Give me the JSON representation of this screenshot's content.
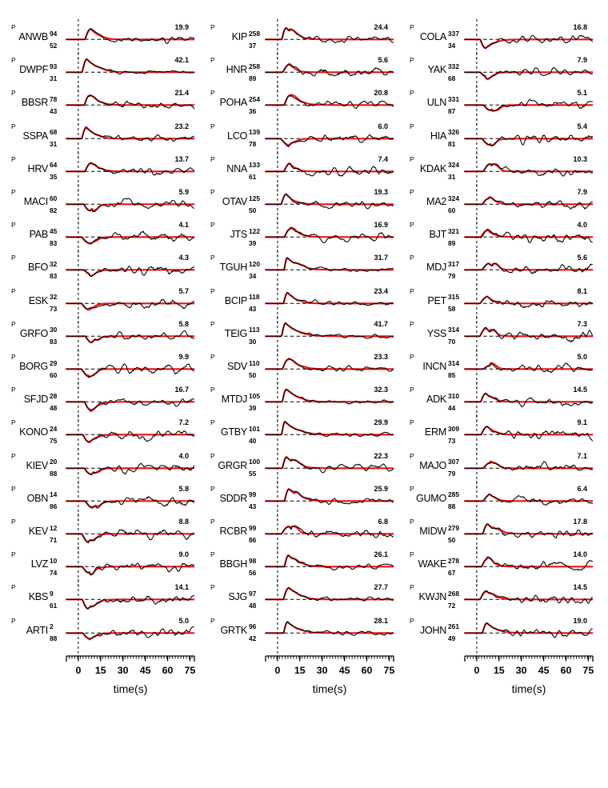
{
  "figure": {
    "type": "seismogram-waveform-comparison",
    "phase_label": "P",
    "axis": {
      "title": "time(s)",
      "tick_labels": [
        "0",
        "15",
        "30",
        "45",
        "60",
        "75"
      ],
      "tick_values": [
        0,
        15,
        30,
        45,
        60,
        75
      ],
      "xmin": -8,
      "xmax": 78,
      "minor_tick_interval": 1.875
    },
    "colors": {
      "observed": "#000000",
      "synthetic": "#ee1111",
      "zero_line": "#000000",
      "origin_line": "#000000"
    }
  },
  "chart_data": {
    "type": "line",
    "title": "",
    "xlabel": "time(s)",
    "ylabel": "",
    "xlim": [
      -8,
      78
    ],
    "grid": false,
    "legend": [
      "observed",
      "synthetic"
    ],
    "columns": [
      {
        "index": 0,
        "traces": [
          {
            "station": "ANWB",
            "phase": "P",
            "azimuth": "94",
            "distance": "52",
            "amplitude": "19.9"
          },
          {
            "station": "DWPF",
            "phase": "P",
            "azimuth": "93",
            "distance": "31",
            "amplitude": "42.1"
          },
          {
            "station": "BBSR",
            "phase": "P",
            "azimuth": "78",
            "distance": "43",
            "amplitude": "21.4"
          },
          {
            "station": "SSPA",
            "phase": "P",
            "azimuth": "68",
            "distance": "31",
            "amplitude": "23.2"
          },
          {
            "station": "HRV",
            "phase": "P",
            "azimuth": "64",
            "distance": "35",
            "amplitude": "13.7"
          },
          {
            "station": "MACI",
            "phase": "P",
            "azimuth": "60",
            "distance": "82",
            "amplitude": "5.9"
          },
          {
            "station": "PAB",
            "phase": "P",
            "azimuth": "45",
            "distance": "83",
            "amplitude": "4.1"
          },
          {
            "station": "BFO",
            "phase": "P",
            "azimuth": "32",
            "distance": "83",
            "amplitude": "4.3"
          },
          {
            "station": "ESK",
            "phase": "P",
            "azimuth": "32",
            "distance": "73",
            "amplitude": "5.7"
          },
          {
            "station": "GRFO",
            "phase": "P",
            "azimuth": "30",
            "distance": "83",
            "amplitude": "5.8"
          },
          {
            "station": "BORG",
            "phase": "P",
            "azimuth": "29",
            "distance": "60",
            "amplitude": "9.9"
          },
          {
            "station": "SFJD",
            "phase": "P",
            "azimuth": "28",
            "distance": "48",
            "amplitude": "16.7"
          },
          {
            "station": "KONO",
            "phase": "P",
            "azimuth": "24",
            "distance": "75",
            "amplitude": "7.2"
          },
          {
            "station": "KIEV",
            "phase": "P",
            "azimuth": "20",
            "distance": "88",
            "amplitude": "4.0"
          },
          {
            "station": "OBN",
            "phase": "P",
            "azimuth": "14",
            "distance": "86",
            "amplitude": "5.8"
          },
          {
            "station": "KEV",
            "phase": "P",
            "azimuth": "12",
            "distance": "71",
            "amplitude": "8.8"
          },
          {
            "station": "LVZ",
            "phase": "P",
            "azimuth": "10",
            "distance": "74",
            "amplitude": "9.0"
          },
          {
            "station": "KBS",
            "phase": "P",
            "azimuth": "9",
            "distance": "61",
            "amplitude": "14.1"
          },
          {
            "station": "ARTI",
            "phase": "P",
            "azimuth": "2",
            "distance": "88",
            "amplitude": "5.0"
          }
        ]
      },
      {
        "index": 1,
        "traces": [
          {
            "station": "KIP",
            "phase": "P",
            "azimuth": "258",
            "distance": "37",
            "amplitude": "24.4"
          },
          {
            "station": "HNR",
            "phase": "P",
            "azimuth": "258",
            "distance": "89",
            "amplitude": "5.6"
          },
          {
            "station": "POHA",
            "phase": "P",
            "azimuth": "254",
            "distance": "36",
            "amplitude": "20.8"
          },
          {
            "station": "LCO",
            "phase": "P",
            "azimuth": "139",
            "distance": "78",
            "amplitude": "6.0"
          },
          {
            "station": "NNA",
            "phase": "P",
            "azimuth": "133",
            "distance": "61",
            "amplitude": "7.4"
          },
          {
            "station": "OTAV",
            "phase": "P",
            "azimuth": "125",
            "distance": "50",
            "amplitude": "19.3"
          },
          {
            "station": "JTS",
            "phase": "P",
            "azimuth": "122",
            "distance": "39",
            "amplitude": "16.9"
          },
          {
            "station": "TGUH",
            "phase": "P",
            "azimuth": "120",
            "distance": "34",
            "amplitude": "31.7"
          },
          {
            "station": "BCIP",
            "phase": "P",
            "azimuth": "118",
            "distance": "43",
            "amplitude": "23.4"
          },
          {
            "station": "TEIG",
            "phase": "P",
            "azimuth": "113",
            "distance": "30",
            "amplitude": "41.7"
          },
          {
            "station": "SDV",
            "phase": "P",
            "azimuth": "110",
            "distance": "50",
            "amplitude": "23.3"
          },
          {
            "station": "MTDJ",
            "phase": "P",
            "azimuth": "105",
            "distance": "39",
            "amplitude": "32.3"
          },
          {
            "station": "GTBY",
            "phase": "P",
            "azimuth": "101",
            "distance": "40",
            "amplitude": "29.9"
          },
          {
            "station": "GRGR",
            "phase": "P",
            "azimuth": "100",
            "distance": "55",
            "amplitude": "22.3"
          },
          {
            "station": "SDDR",
            "phase": "P",
            "azimuth": "99",
            "distance": "43",
            "amplitude": "25.9"
          },
          {
            "station": "RCBR",
            "phase": "P",
            "azimuth": "99",
            "distance": "86",
            "amplitude": "6.8"
          },
          {
            "station": "BBGH",
            "phase": "P",
            "azimuth": "98",
            "distance": "56",
            "amplitude": "26.1"
          },
          {
            "station": "SJG",
            "phase": "P",
            "azimuth": "97",
            "distance": "48",
            "amplitude": "27.7"
          },
          {
            "station": "GRTK",
            "phase": "P",
            "azimuth": "96",
            "distance": "42",
            "amplitude": "28.1"
          }
        ]
      },
      {
        "index": 2,
        "traces": [
          {
            "station": "COLA",
            "phase": "P",
            "azimuth": "337",
            "distance": "34",
            "amplitude": "16.8"
          },
          {
            "station": "YAK",
            "phase": "P",
            "azimuth": "332",
            "distance": "68",
            "amplitude": "7.9"
          },
          {
            "station": "ULN",
            "phase": "P",
            "azimuth": "331",
            "distance": "87",
            "amplitude": "5.1"
          },
          {
            "station": "HIA",
            "phase": "P",
            "azimuth": "326",
            "distance": "81",
            "amplitude": "5.4"
          },
          {
            "station": "KDAK",
            "phase": "P",
            "azimuth": "324",
            "distance": "31",
            "amplitude": "10.3"
          },
          {
            "station": "MA2",
            "phase": "P",
            "azimuth": "324",
            "distance": "60",
            "amplitude": "7.9"
          },
          {
            "station": "BJT",
            "phase": "P",
            "azimuth": "321",
            "distance": "89",
            "amplitude": "4.0"
          },
          {
            "station": "MDJ",
            "phase": "P",
            "azimuth": "317",
            "distance": "79",
            "amplitude": "5.6"
          },
          {
            "station": "PET",
            "phase": "P",
            "azimuth": "315",
            "distance": "58",
            "amplitude": "8.1"
          },
          {
            "station": "YSS",
            "phase": "P",
            "azimuth": "314",
            "distance": "70",
            "amplitude": "7.3"
          },
          {
            "station": "INCN",
            "phase": "P",
            "azimuth": "314",
            "distance": "85",
            "amplitude": "5.0"
          },
          {
            "station": "ADK",
            "phase": "P",
            "azimuth": "310",
            "distance": "44",
            "amplitude": "14.5"
          },
          {
            "station": "ERM",
            "phase": "P",
            "azimuth": "309",
            "distance": "73",
            "amplitude": "9.1"
          },
          {
            "station": "MAJO",
            "phase": "P",
            "azimuth": "307",
            "distance": "79",
            "amplitude": "7.1"
          },
          {
            "station": "GUMO",
            "phase": "P",
            "azimuth": "285",
            "distance": "88",
            "amplitude": "6.4"
          },
          {
            "station": "MIDW",
            "phase": "P",
            "azimuth": "279",
            "distance": "50",
            "amplitude": "17.8"
          },
          {
            "station": "WAKE",
            "phase": "P",
            "azimuth": "278",
            "distance": "67",
            "amplitude": "14.0"
          },
          {
            "station": "KWJN",
            "phase": "P",
            "azimuth": "268",
            "distance": "72",
            "amplitude": "14.5"
          },
          {
            "station": "JOHN",
            "phase": "P",
            "azimuth": "261",
            "distance": "49",
            "amplitude": "19.0"
          }
        ]
      }
    ]
  }
}
